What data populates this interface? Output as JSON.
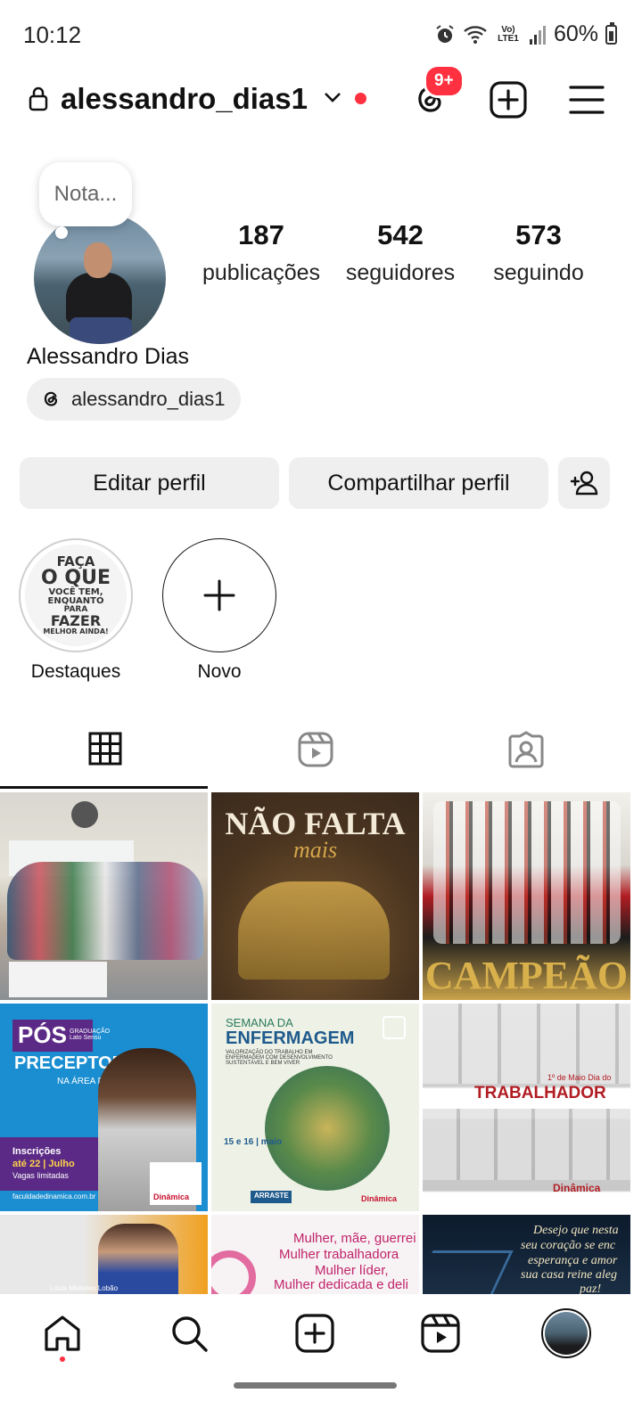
{
  "status_bar": {
    "time": "10:12",
    "network": "Vo) LTE1",
    "battery": "60%"
  },
  "header": {
    "username": "alessandro_dias1",
    "threads_badge": "9+"
  },
  "profile": {
    "note_placeholder": "Nota...",
    "full_name": "Alessandro Dias",
    "threads_handle": "alessandro_dias1",
    "stats": [
      {
        "value": "187",
        "label": "publicações"
      },
      {
        "value": "542",
        "label": "seguidores"
      },
      {
        "value": "573",
        "label": "seguindo"
      }
    ]
  },
  "buttons": {
    "edit": "Editar perfil",
    "share": "Compartilhar perfil"
  },
  "highlights": [
    {
      "label": "Destaques",
      "art_lines": [
        "FAÇA",
        "O QUE",
        "VOCÊ TEM,",
        "ENQUANTO",
        "PARA",
        "FAZER",
        "MELHOR AINDA!"
      ]
    },
    {
      "label": "Novo"
    }
  ],
  "tabs": [
    "grid-icon",
    "reels-icon",
    "tagged-icon"
  ],
  "posts": [
    {
      "kind": "photo",
      "caption": ""
    },
    {
      "kind": "graphic",
      "title": "NÃO FALTA",
      "subtitle": "mais"
    },
    {
      "kind": "graphic",
      "title": "CAMPEÃO"
    },
    {
      "kind": "graphic",
      "tag": "PÓS",
      "tag_small": "GRADUAÇÃO Lato Sensu",
      "title": "PRECEPTORIA",
      "subtitle": "NA ÁREA DA SAÚDE",
      "info1": "Inscrições",
      "info2": "até 22 | Julho",
      "info3": "Vagas limitadas",
      "site": "faculdadedinamica.com.br",
      "brand": "Dinâmica"
    },
    {
      "kind": "graphic",
      "title_small": "SEMANA DA",
      "title": "ENFERMAGEM",
      "subtitle": "VALORIZAÇÃO DO TRABALHO EM ENFERMAGEM COM DESENVOLVIMENTO SUSTENTÁVEL E BEM VIVER",
      "date": "15 e 16 | maio",
      "cta": "ARRASTE",
      "brand": "Dinâmica"
    },
    {
      "kind": "graphic",
      "title_small": "1º de Maio Dia do",
      "title": "TRABALHADOR",
      "brand": "Dinâmica"
    },
    {
      "kind": "graphic",
      "caption": "Louis Meireles Lobão"
    },
    {
      "kind": "graphic",
      "lines": [
        "Mulher, mãe, guerrei",
        "Mulher trabalhadora",
        "Mulher líder,",
        "Mulher dedicada e deli"
      ]
    },
    {
      "kind": "graphic",
      "lines": [
        "Desejo que nesta",
        "seu coração se enc",
        "esperança e amor",
        "sua casa reine aleg",
        "paz!"
      ]
    }
  ],
  "colors": {
    "notification": "#ff3040",
    "text": "#111111",
    "button_bg": "#efefef"
  }
}
